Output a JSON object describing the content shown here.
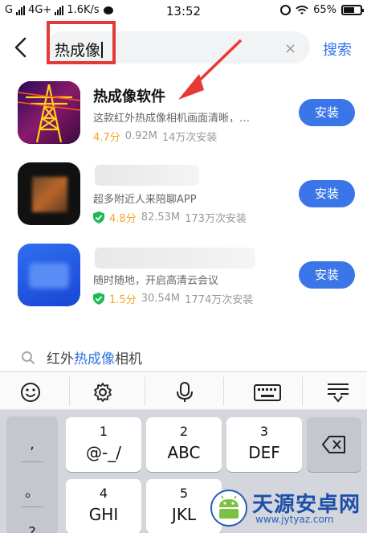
{
  "status_bar": {
    "carrier1": "G",
    "carrier2": "4G+",
    "speed": "1.6K/s",
    "time": "13:52",
    "battery": "65%",
    "battery_level": 0.65
  },
  "search": {
    "query": "热成像",
    "clear_icon": "×",
    "button_label": "搜索"
  },
  "apps": [
    {
      "name": "热成像软件",
      "desc": "这款红外热成像相机画面清晰，…",
      "rating": "4.7分",
      "size": "0.92M",
      "installs": "14万次安装",
      "verified": false,
      "install_label": "安装"
    },
    {
      "name": "",
      "desc": "超多附近人来陪聊APP",
      "rating": "4.8分",
      "size": "82.53M",
      "installs": "173万次安装",
      "verified": true,
      "install_label": "安装"
    },
    {
      "name": "",
      "desc": "随时随地，开启高清云会议",
      "rating": "1.5分",
      "size": "30.54M",
      "installs": "1774万次安装",
      "verified": true,
      "install_label": "安装"
    }
  ],
  "suggestion": {
    "prefix": "红外",
    "highlight": "热成像",
    "suffix": "相机"
  },
  "keyboard": {
    "toolbar_icons": [
      "emoji-icon",
      "gear-icon",
      "microphone-icon",
      "keyboard-icon",
      "collapse-keyboard-icon"
    ],
    "side_keys": [
      ",",
      "。",
      "?"
    ],
    "keys": [
      {
        "num": "1",
        "letters": "@-_/"
      },
      {
        "num": "2",
        "letters": "ABC"
      },
      {
        "num": "3",
        "letters": "DEF"
      },
      {
        "num": "4",
        "letters": "GHI"
      },
      {
        "num": "5",
        "letters": "JKL"
      }
    ]
  },
  "watermark": {
    "name": "天源安卓网",
    "url": "www.jytyaz.com"
  },
  "colors": {
    "accent": "#3b76e8",
    "rating": "#f5a623",
    "annotation": "#e53935",
    "verified": "#1db954"
  }
}
